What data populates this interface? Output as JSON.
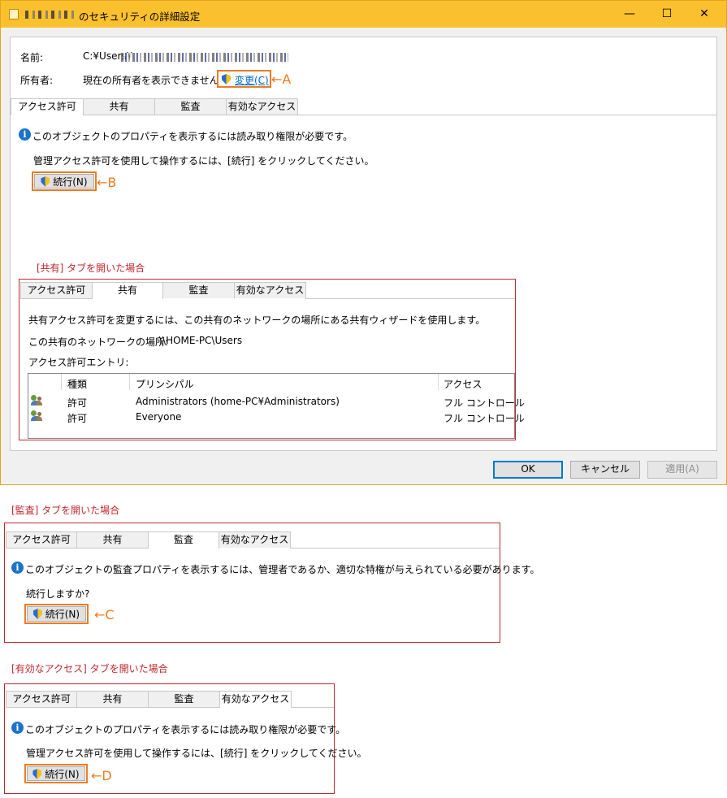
{
  "window": {
    "title": "のセキュリティの詳細設定",
    "minimize_glyph": "—",
    "maximize_glyph": "☐",
    "close_glyph": "✕"
  },
  "owner": {
    "name_label": "名前:",
    "path_prefix": "C:¥Users¥",
    "owner_label": "所有者:",
    "owner_value": "現在の所有者を表示できません。",
    "change_button": "変更(C)",
    "marker_a": "←A"
  },
  "tabs": [
    "アクセス許可",
    "共有",
    "監査",
    "有効なアクセス"
  ],
  "permissions_tab": {
    "info": "このオブジェクトのプロパティを表示するには読み取り権限が必要です。",
    "instruction": "管理アクセス許可を使用して操作するには、[続行] をクリックしてください。",
    "continue_button": "続行(N)",
    "marker_b": "←B"
  },
  "share_section": {
    "caption": "[共有] タブを開いた場合",
    "line1": "共有アクセス許可を変更するには、この共有のネットワークの場所にある共有ウィザードを使用します。",
    "location_label": "この共有のネットワークの場所:",
    "location_value": "\\\\HOME-PC\\Users",
    "entries_label": "アクセス許可エントリ:",
    "columns": [
      "種類",
      "プリンシパル",
      "アクセス"
    ],
    "rows": [
      {
        "type": "許可",
        "principal": "Administrators (home-PC¥Administrators)",
        "access": "フル コントロール"
      },
      {
        "type": "許可",
        "principal": "Everyone",
        "access": "フル コントロール"
      }
    ]
  },
  "dialog_buttons": {
    "ok": "OK",
    "cancel": "キャンセル",
    "apply": "適用(A)"
  },
  "audit_section": {
    "caption": "[監査] タブを開いた場合",
    "info": "このオブジェクトの監査プロパティを表示するには、管理者であるか、適切な特権が与えられている必要があります。",
    "question": "続行しますか?",
    "continue_button": "続行(N)",
    "marker_c": "←C"
  },
  "effective_section": {
    "caption": "[有効なアクセス] タブを開いた場合",
    "info": "このオブジェクトのプロパティを表示するには読み取り権限が必要です。",
    "instruction": "管理アクセス許可を使用して操作するには、[続行] をクリックしてください。",
    "continue_button": "続行(N)",
    "marker_d": "←D"
  },
  "colors": {
    "titlebar": "#fbc02d",
    "highlight": "#ee7b22",
    "annotation_red": "#c0272d",
    "info_blue": "#1a73c9"
  }
}
